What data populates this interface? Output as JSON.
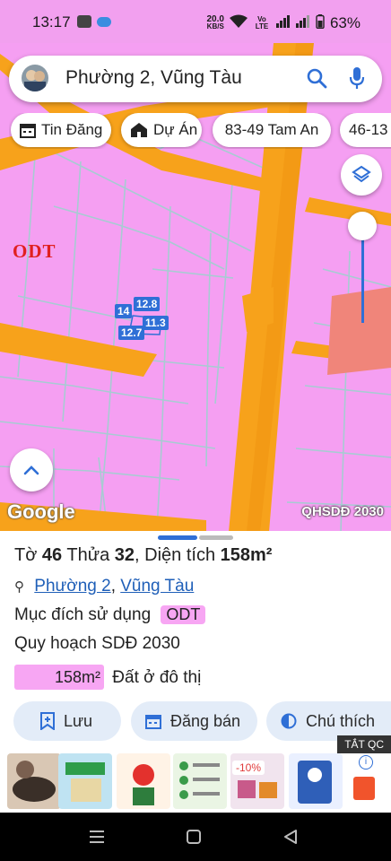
{
  "status_bar": {
    "time": "13:17",
    "speed_value": "20.0",
    "speed_unit": "KB/S",
    "volte": "Vo LTE",
    "battery": "63%"
  },
  "search": {
    "query": "Phường 2, Vũng Tàu"
  },
  "chips": [
    {
      "label": "Tin Đăng"
    },
    {
      "label": "Dự Án"
    },
    {
      "label": "83-49 Tam An"
    },
    {
      "label": "46-13"
    }
  ],
  "map": {
    "zone_label": "ODT",
    "dimensions": [
      "12.8",
      "14",
      "11.3",
      "12.7"
    ],
    "google_logo": "Google",
    "layer_label": "QHSDĐ 2030"
  },
  "parcel": {
    "sheet_label": "Tờ",
    "sheet_no": "46",
    "lot_label": "Thửa",
    "lot_no": "32",
    "area_label": "Diện tích",
    "area_value": "158m²",
    "ward": "Phường 2",
    "city": "Vũng Tàu",
    "purpose_label": "Mục đích sử dụng",
    "purpose_code": "ODT",
    "plan_label": "Quy hoạch SDĐ 2030",
    "plan_area": "158m²",
    "plan_type": "Đất ở đô thị"
  },
  "actions": [
    {
      "label": "Lưu"
    },
    {
      "label": "Đăng bán"
    },
    {
      "label": "Chú thích"
    }
  ],
  "ad": {
    "hide_label": "TẮT QC",
    "discount": "-10%"
  },
  "colors": {
    "pink_zone": "#f59ff2",
    "road": "#f7a21b",
    "parcel_line": "#9fd0cf",
    "accent": "#2f6fd6"
  }
}
